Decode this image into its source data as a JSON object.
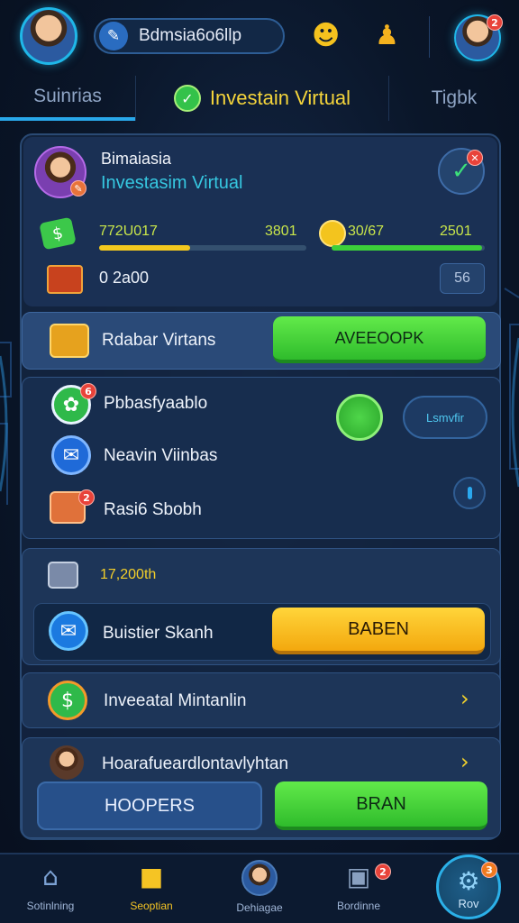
{
  "header": {
    "search_text": "Bdmsia6o6llp",
    "profile_badge": "2"
  },
  "tabs": {
    "left": "Suinrias",
    "middle": "Investain Virtual",
    "right": "Tigbk"
  },
  "profile": {
    "name": "Bimaiasia",
    "subtitle": "Investasim Virtual",
    "stat1_left": "772U017",
    "stat1_right": "3801",
    "stat1_progress": 0.44,
    "stat2_left": "30/67",
    "stat2_right": "2501",
    "stat2_progress": 0.98,
    "coins_value": "0 2a00",
    "small_button": "56"
  },
  "promo": {
    "label": "Rdabar Virtans",
    "button": "AVEEOOPK"
  },
  "list": {
    "item1": "Pbbasfyaablo",
    "item1_badge": "6",
    "item2": "Neavin Viinbas",
    "item3": "Rasi6 Sbobh",
    "item3_badge": "2",
    "side_button": "Lsmvfir"
  },
  "rewards": {
    "amount": "17,200th",
    "row_label": "Buistier Skanh",
    "row_button": "BABEN"
  },
  "invest_row": {
    "label": "Inveeatal Mintanlin"
  },
  "last_card": {
    "label": "Hoarafueardlontavlyhtan",
    "button_left": "HOOPERS",
    "button_right": "BRAN"
  },
  "bottom_nav": [
    {
      "label": "Sotinlning"
    },
    {
      "label": "Seoptian"
    },
    {
      "label": "Dehiagae"
    },
    {
      "label": "Bordinne",
      "badge": "2"
    },
    {
      "label": "Rov",
      "badge": "3"
    }
  ],
  "colors": {
    "accent": "#29a8ea",
    "green": "#3ccf3a",
    "yellow": "#f5c424",
    "panel": "#1b3458"
  },
  "icons": [
    "search-icon",
    "sun-icon",
    "bell-icon",
    "check-icon",
    "money-icon",
    "coin-icon",
    "gear-icon",
    "chat-icon",
    "gift-icon",
    "chevron-right-icon",
    "lock-icon",
    "card-icon",
    "avatar-icon",
    "gamepad-icon",
    "settings-icon"
  ]
}
